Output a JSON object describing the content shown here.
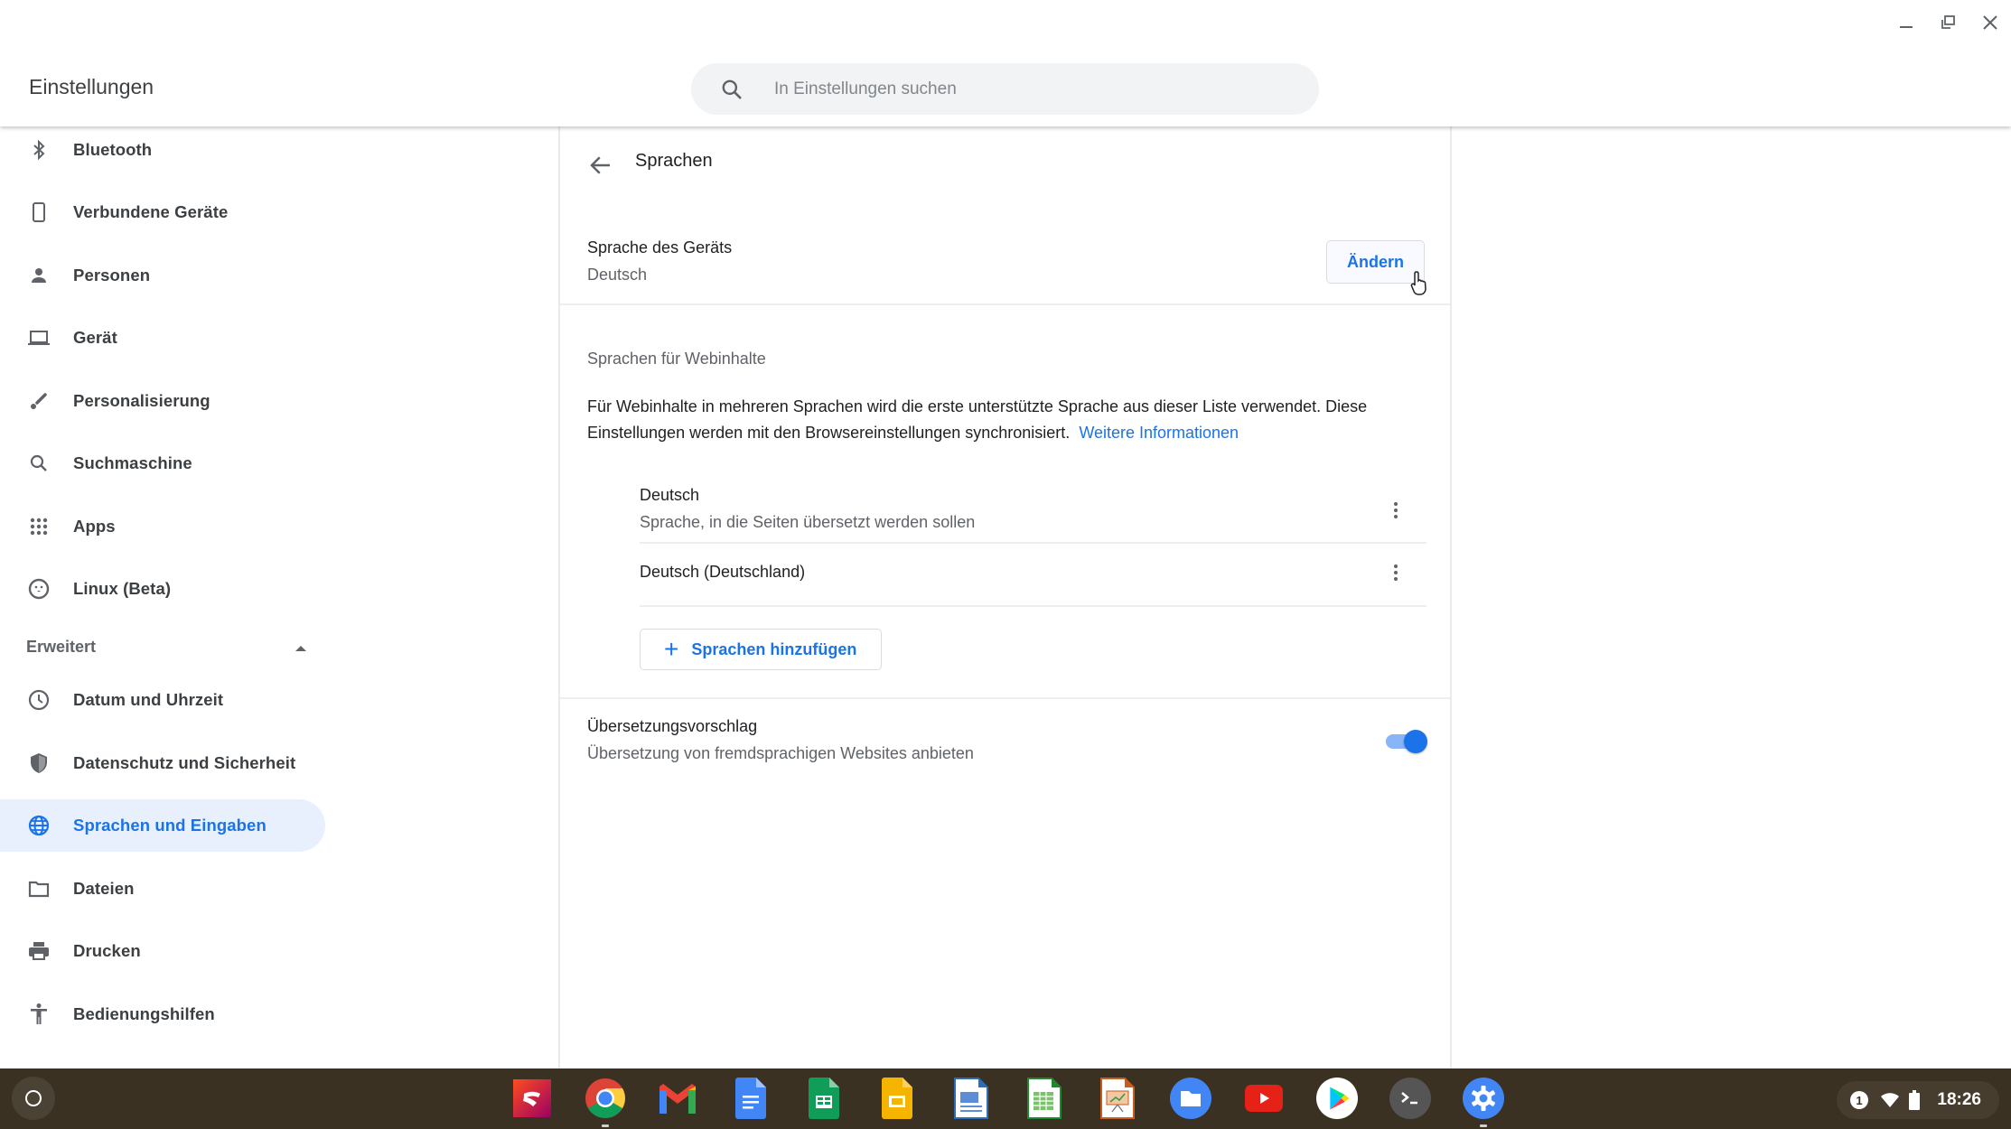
{
  "window": {
    "title": "Einstellungen",
    "controls": [
      "minimize",
      "restore",
      "close"
    ]
  },
  "search": {
    "placeholder": "In Einstellungen suchen",
    "value": ""
  },
  "sidebar": {
    "items": [
      {
        "label": "Bluetooth",
        "icon": "bluetooth-icon"
      },
      {
        "label": "Verbundene Geräte",
        "icon": "phone-icon"
      },
      {
        "label": "Personen",
        "icon": "person-icon"
      },
      {
        "label": "Gerät",
        "icon": "laptop-icon"
      },
      {
        "label": "Personalisierung",
        "icon": "brush-icon"
      },
      {
        "label": "Suchmaschine",
        "icon": "search-icon"
      },
      {
        "label": "Apps",
        "icon": "apps-grid-icon"
      },
      {
        "label": "Linux (Beta)",
        "icon": "linux-penguin-icon"
      }
    ],
    "advanced": {
      "label": "Erweitert",
      "expanded": true,
      "items": [
        {
          "label": "Datum und Uhrzeit",
          "icon": "clock-icon"
        },
        {
          "label": "Datenschutz und Sicherheit",
          "icon": "shield-icon"
        },
        {
          "label": "Sprachen und Eingaben",
          "icon": "globe-icon",
          "active": true
        },
        {
          "label": "Dateien",
          "icon": "folder-icon"
        },
        {
          "label": "Drucken",
          "icon": "printer-icon"
        },
        {
          "label": "Bedienungshilfen",
          "icon": "accessibility-icon"
        }
      ]
    }
  },
  "main": {
    "title": "Sprachen",
    "device_language": {
      "label": "Sprache des Geräts",
      "value": "Deutsch",
      "button": "Ändern"
    },
    "web_languages": {
      "heading": "Sprachen für Webinhalte",
      "description": "Für Webinhalte in mehreren Sprachen wird die erste unterstützte Sprache aus dieser Liste verwendet. Diese Einstellungen werden mit den Browsereinstellungen synchronisiert.",
      "link": "Weitere Informationen",
      "languages": [
        {
          "name": "Deutsch",
          "sub": "Sprache, in die Seiten übersetzt werden sollen"
        },
        {
          "name": "Deutsch (Deutschland)",
          "sub": ""
        }
      ],
      "add_button": "Sprachen hinzufügen"
    },
    "translate": {
      "label": "Übersetzungsvorschlag",
      "sub": "Übersetzung von fremdsprachigen Websites anbieten",
      "enabled": true
    }
  },
  "shelf": {
    "apps": [
      "Stadia",
      "Chrome",
      "Gmail",
      "Google Docs",
      "Google Sheets",
      "Google Slides",
      "LibreOffice Writer",
      "LibreOffice Calc",
      "LibreOffice Impress",
      "Files",
      "YouTube",
      "Play Store",
      "Terminal",
      "Settings"
    ],
    "tray": {
      "notification_count": "1",
      "time": "18:26"
    }
  },
  "colors": {
    "accent": "#1a73e8",
    "active_bg": "#e8f0fe",
    "shelf_bg": "#3a3122"
  }
}
